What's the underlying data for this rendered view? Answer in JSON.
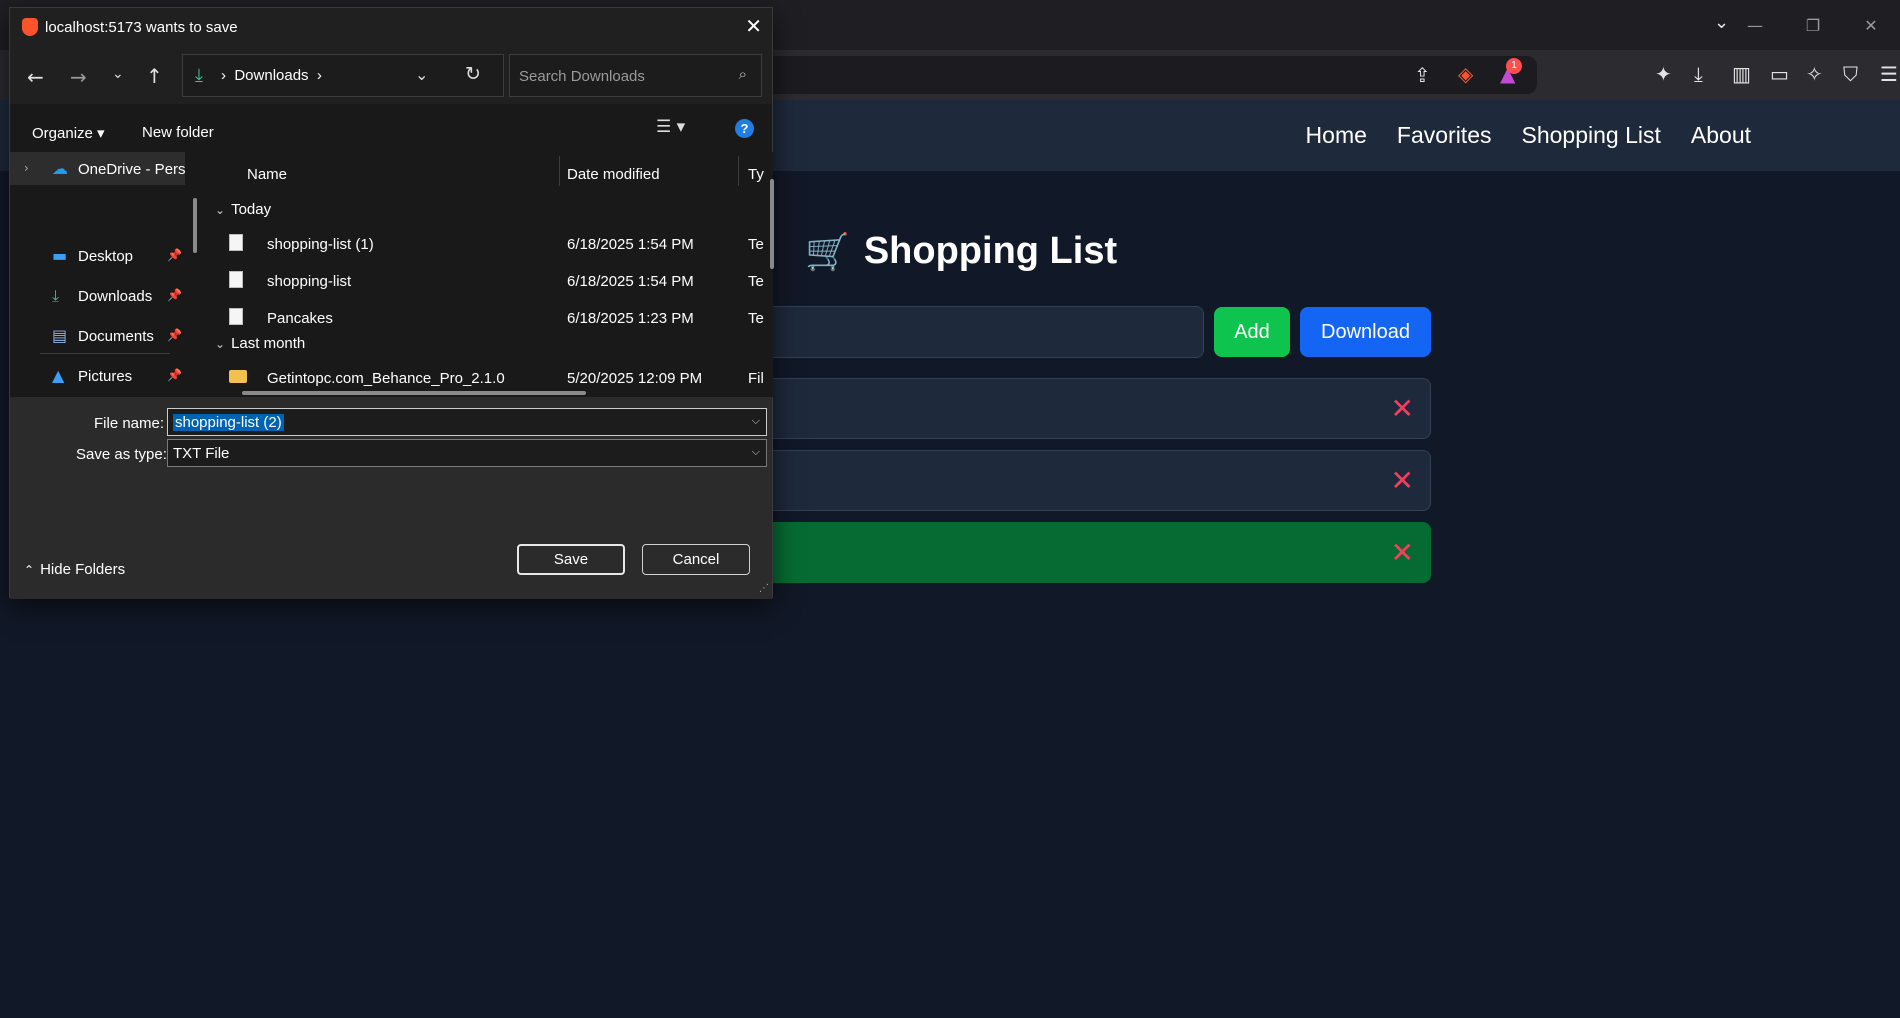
{
  "browser": {
    "window_controls": [
      "—",
      "❐",
      "✕"
    ],
    "shields_badge": "1"
  },
  "page": {
    "nav": [
      "Home",
      "Favorites",
      "Shopping List",
      "About"
    ],
    "title": "Shopping List",
    "title_icon": "shopping-cart-icon",
    "add_label": "Add",
    "download_label": "Download",
    "delete_symbol": "✕",
    "colors": {
      "add": "#0fc44e",
      "download": "#1565f5",
      "done_item": "#066b32",
      "delete": "#f43f5e"
    }
  },
  "dialog": {
    "title": "localhost:5173 wants to save",
    "breadcrumb": "Downloads",
    "search_placeholder": "Search Downloads",
    "organize_label": "Organize",
    "new_folder_label": "New folder",
    "help_label": "?",
    "nav_pane": [
      {
        "label": "OneDrive - Personal",
        "icon": "onedrive-icon"
      },
      {
        "label": "Desktop",
        "icon": "desktop-icon"
      },
      {
        "label": "Downloads",
        "icon": "downloads-icon"
      },
      {
        "label": "Documents",
        "icon": "documents-icon"
      },
      {
        "label": "Pictures",
        "icon": "pictures-icon"
      }
    ],
    "columns": {
      "name": "Name",
      "date": "Date modified",
      "type": "Ty"
    },
    "groups": [
      {
        "label": "Today",
        "files": [
          {
            "name": "shopping-list (1)",
            "date": "6/18/2025 1:54 PM",
            "type": "Te"
          },
          {
            "name": "shopping-list",
            "date": "6/18/2025 1:54 PM",
            "type": "Te"
          },
          {
            "name": "Pancakes",
            "date": "6/18/2025 1:23 PM",
            "type": "Te"
          }
        ]
      },
      {
        "label": "Last month",
        "files": [
          {
            "name": "Getintopc.com_Behance_Pro_2.1.0",
            "date": "5/20/2025 12:09 PM",
            "type": "Fil"
          }
        ]
      }
    ],
    "file_name_label": "File name:",
    "file_name_value": "shopping-list (2)",
    "save_type_label": "Save as type:",
    "save_type_value": "TXT File",
    "hide_folders_label": "Hide Folders",
    "save_label": "Save",
    "cancel_label": "Cancel"
  }
}
